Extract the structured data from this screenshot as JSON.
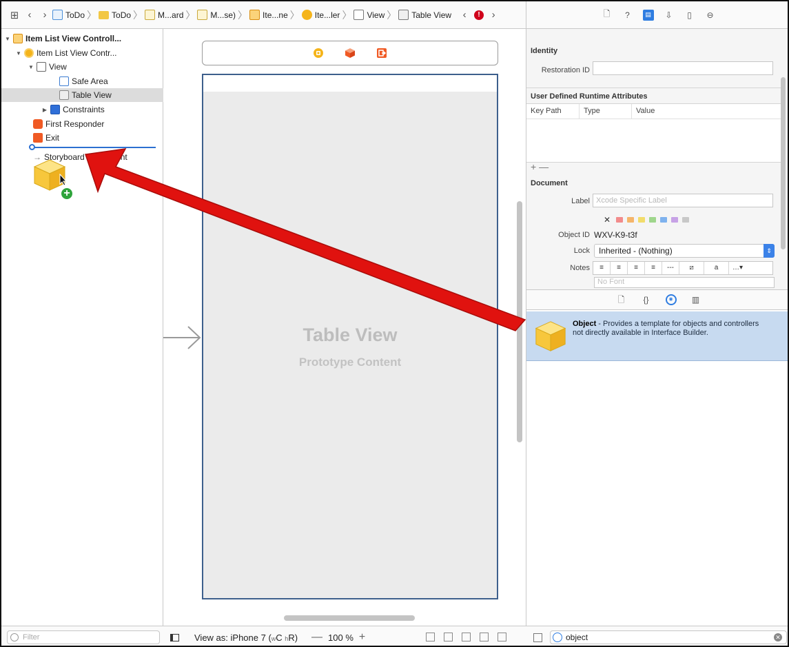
{
  "jumpbar": {
    "crumbs": [
      {
        "label": "ToDo",
        "icon": "project-file-icon"
      },
      {
        "label": "ToDo",
        "icon": "folder-icon"
      },
      {
        "label": "M...ard",
        "icon": "storyboard-icon"
      },
      {
        "label": "M...se)",
        "icon": "storyboard-icon"
      },
      {
        "label": "Ite...ne",
        "icon": "scene-icon"
      },
      {
        "label": "Ite...ler",
        "icon": "view-controller-icon"
      },
      {
        "label": "View",
        "icon": "view-icon"
      },
      {
        "label": "Table View",
        "icon": "table-view-icon"
      }
    ],
    "error_count": "!"
  },
  "outline": {
    "items": [
      {
        "label": "Item List View Controll...",
        "bold": true
      },
      {
        "label": "Item List View Contr..."
      },
      {
        "label": "View"
      },
      {
        "label": "Safe Area"
      },
      {
        "label": "Table View"
      },
      {
        "label": "Constraints"
      },
      {
        "label": "First Responder"
      },
      {
        "label": "Exit"
      },
      {
        "label": "Storyboard Entry Point"
      }
    ],
    "filter_placeholder": "Filter"
  },
  "canvas": {
    "table_title": "Table View",
    "table_subtitle": "Prototype Content"
  },
  "inspector": {
    "identity": {
      "heading": "Identity",
      "restoration_label": "Restoration ID",
      "restoration_value": ""
    },
    "udra": {
      "heading": "User Defined Runtime Attributes",
      "col_keypath": "Key Path",
      "col_type": "Type",
      "col_value": "Value",
      "add_remove": "+ —"
    },
    "document": {
      "heading": "Document",
      "label_label": "Label",
      "label_placeholder": "Xcode Specific Label",
      "object_id_label": "Object ID",
      "object_id_value": "WXV-K9-t3f",
      "lock_label": "Lock",
      "lock_value": "Inherited - (Nothing)",
      "notes_label": "Notes",
      "font_placeholder": "No Font"
    },
    "swatch_colors": [
      "#f28b8b",
      "#f5b56a",
      "#f2dc6b",
      "#9fd68c",
      "#7fb2ee",
      "#c7a2e6",
      "#c8c8c8"
    ]
  },
  "library": {
    "item_title": "Object",
    "item_desc": " - Provides a template for objects and controllers not directly available in Interface Builder."
  },
  "bottombar": {
    "view_as": "View as: iPhone 7 (",
    "view_as_w": "w",
    "view_as_c": "C",
    "view_as_h": "h",
    "view_as_r": "R)",
    "zoom_minus": "—",
    "zoom": "100 %",
    "zoom_plus": "+",
    "library_search": "object"
  },
  "colors": {
    "accent": "#2f7de1",
    "arrow": "#e0120f",
    "table_border": "#3d5f8c",
    "selection": "#c7daf0"
  }
}
